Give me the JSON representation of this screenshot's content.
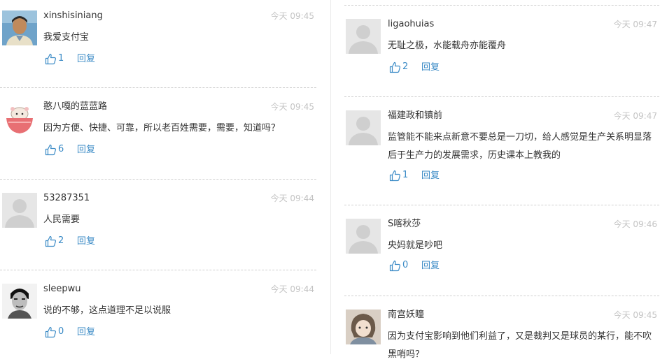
{
  "left": [
    {
      "user": "xinshisiniang",
      "time": "今天 09:45",
      "text": "我爱支付宝",
      "likes": "1",
      "reply": "回复",
      "avatar": "photo-man-icon"
    },
    {
      "user": "憨八嘎的蓝蓝路",
      "time": "今天 09:45",
      "text": "因为方便、快捷、可靠，所以老百姓需要，需要，知道吗？",
      "likes": "6",
      "reply": "回复",
      "avatar": "hamster-bowl-icon"
    },
    {
      "user": "53287351",
      "time": "今天 09:44",
      "text": "人民需要",
      "likes": "2",
      "reply": "回复",
      "avatar": "default-avatar-icon"
    },
    {
      "user": "sleepwu",
      "time": "今天 09:44",
      "text": "说的不够，这点道理不足以说服",
      "likes": "0",
      "reply": "回复",
      "avatar": "bruce-lee-photo-icon"
    }
  ],
  "right": [
    {
      "user": "ligaohuias",
      "time": "今天 09:47",
      "text": "无耻之极，水能载舟亦能覆舟",
      "likes": "2",
      "reply": "回复",
      "avatar": "default-avatar-icon"
    },
    {
      "user": "福建政和镇前",
      "time": "今天 09:47",
      "text": "监管能不能来点新意不要总是一刀切，给人感觉是生产关系明显落后于生产力的发展需求，历史课本上教我的",
      "likes": "1",
      "reply": "回复",
      "avatar": "default-avatar-icon"
    },
    {
      "user": "S喀秋莎",
      "time": "今天 09:46",
      "text": "央妈就是吵吧",
      "likes": "0",
      "reply": "回复",
      "avatar": "default-avatar-icon"
    },
    {
      "user": "南宫妖瞳",
      "time": "今天 09:45",
      "text": "因为支付宝影响到他们利益了，又是裁判又是球员的某行，能不吹黑哨吗？",
      "likes": "",
      "reply": "",
      "avatar": "anime-girl-avatar-icon"
    }
  ],
  "colors": {
    "link": "#3b8bc6",
    "time": "#c4c4c4",
    "text": "#333333",
    "separator": "#cfcfcf"
  }
}
